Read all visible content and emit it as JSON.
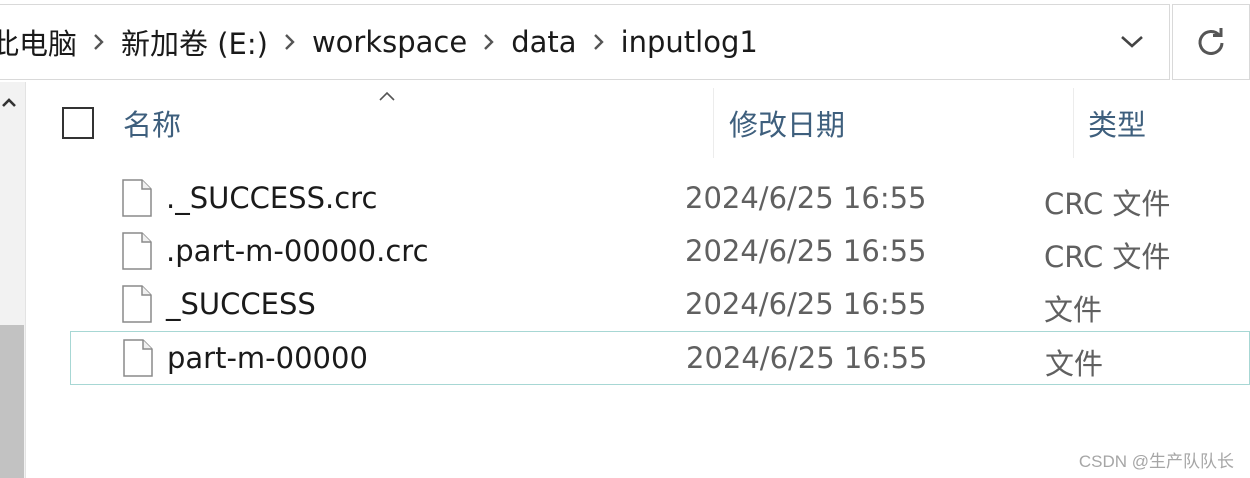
{
  "address": {
    "crumbs": [
      "此电脑",
      "新加卷 (E:)",
      "workspace",
      "data",
      "inputlog1"
    ],
    "dropdown_icon": "chevron-down-icon",
    "refresh_icon": "refresh-icon"
  },
  "columns": {
    "name": "名称",
    "date": "修改日期",
    "type": "类型"
  },
  "files": [
    {
      "name": "._SUCCESS.crc",
      "date": "2024/6/25 16:55",
      "type": "CRC 文件"
    },
    {
      "name": ".part-m-00000.crc",
      "date": "2024/6/25 16:55",
      "type": "CRC 文件"
    },
    {
      "name": "_SUCCESS",
      "date": "2024/6/25 16:55",
      "type": "文件"
    },
    {
      "name": "part-m-00000",
      "date": "2024/6/25 16:55",
      "type": "文件",
      "selected": true
    }
  ],
  "watermark": "CSDN @生产队队长",
  "colors": {
    "header_text": "#3e5f7d",
    "selection_border": "#a7d7d4"
  }
}
